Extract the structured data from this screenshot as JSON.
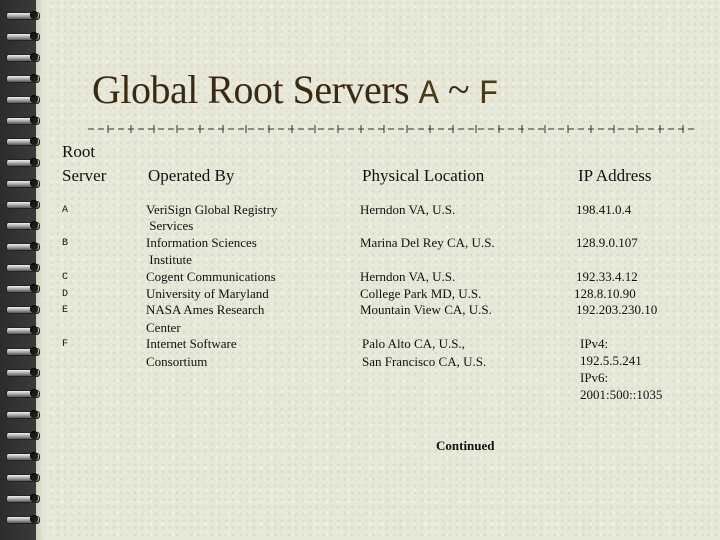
{
  "slide": {
    "title_main": "Global Root Servers ",
    "title_a": "A",
    "title_sep": " ~ ",
    "title_f": "F",
    "continued": "Continued"
  },
  "table": {
    "headers": {
      "root_server_line1": "Root",
      "root_server_line2": "Server",
      "operated_by": "Operated By",
      "physical_location": "Physical Location",
      "ip_address": "IP Address"
    },
    "letters": [
      "A",
      "B",
      "C",
      "D",
      "E",
      "F"
    ],
    "operated_by_lines": [
      "VeriSign Global Registry",
      " Services",
      "Information Sciences",
      " Institute",
      "Cogent Communications",
      "University of Maryland",
      "NASA Ames Research",
      "Center",
      "Internet Software",
      "Consortium"
    ],
    "location_lines": [
      "Herndon VA, U.S.",
      "Marina Del Rey CA, U.S.",
      "Herndon VA, U.S.",
      "College Park MD, U.S.",
      "Mountain View CA, U.S.",
      "Palo Alto CA, U.S.,",
      "San Francisco CA, U.S."
    ],
    "ip_lines": [
      "198.41.0.4",
      "128.9.0.107",
      "192.33.4.12",
      "128.8.10.90",
      "192.203.230.10",
      "IPv4:",
      "192.5.5.241",
      "IPv6:",
      "2001:500::1035"
    ]
  }
}
